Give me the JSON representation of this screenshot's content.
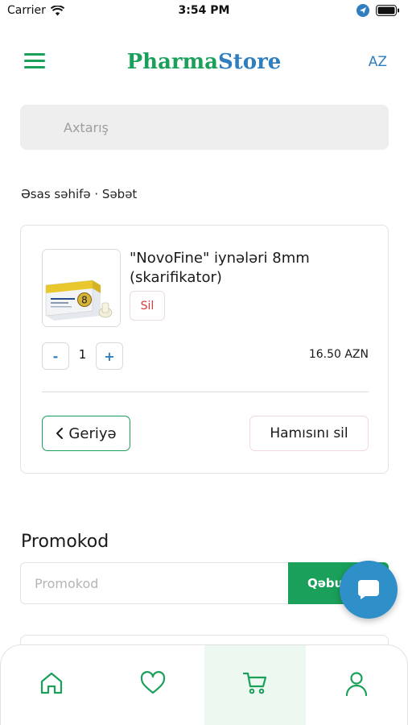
{
  "status_bar": {
    "carrier": "Carrier",
    "time": "3:54 PM"
  },
  "header": {
    "brand_part1": "Pharma",
    "brand_part2": "Store",
    "language": "AZ"
  },
  "search": {
    "placeholder": "Axtarış"
  },
  "breadcrumb": {
    "text": "Əsas səhifə · Səbət"
  },
  "cart": {
    "item": {
      "name": "\"NovoFine\" iynələri 8mm (skarifikator)",
      "remove_label": "Sil",
      "quantity": "1",
      "price": "16.50 AZN",
      "image_label": "8"
    },
    "qty_minus": "-",
    "qty_plus": "+",
    "back_label": "Geriyə",
    "clear_label": "Hamısını sil"
  },
  "promo": {
    "title": "Promokod",
    "placeholder": "Promokod",
    "apply_label": "Qəbul"
  },
  "bottom_nav": [
    "home-icon",
    "heart-icon",
    "cart-icon",
    "user-icon"
  ],
  "colors": {
    "brand_green": "#1aa05a",
    "brand_blue": "#2f7fc0",
    "remove_red": "#d93a3a",
    "chat_blue": "#2f8fc9"
  }
}
